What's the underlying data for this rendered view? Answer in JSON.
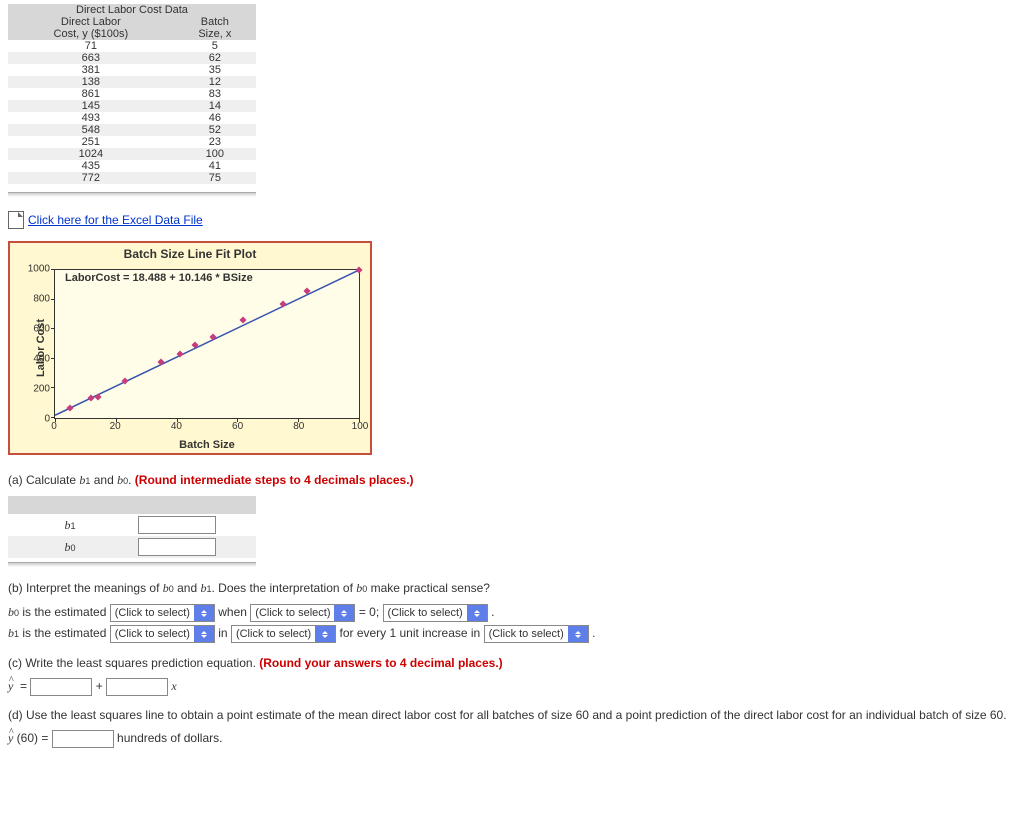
{
  "table": {
    "title": "Direct Labor Cost Data",
    "col1_a": "Direct Labor",
    "col1_b": "Cost, y ($100s)",
    "col2_a": "Batch",
    "col2_b": "Size, x",
    "rows": [
      {
        "y": "71",
        "x": "5"
      },
      {
        "y": "663",
        "x": "62"
      },
      {
        "y": "381",
        "x": "35"
      },
      {
        "y": "138",
        "x": "12"
      },
      {
        "y": "861",
        "x": "83"
      },
      {
        "y": "145",
        "x": "14"
      },
      {
        "y": "493",
        "x": "46"
      },
      {
        "y": "548",
        "x": "52"
      },
      {
        "y": "251",
        "x": "23"
      },
      {
        "y": "1024",
        "x": "100"
      },
      {
        "y": "435",
        "x": "41"
      },
      {
        "y": "772",
        "x": "75"
      }
    ]
  },
  "excel_link": "Click here for the Excel Data File",
  "chart_data": {
    "type": "scatter",
    "title": "Batch Size Line Fit Plot",
    "equation_label": "LaborCost = 18.488 + 10.146 * BSize",
    "xlabel": "Batch Size",
    "ylabel": "Labor Cost",
    "xlim": [
      0,
      100
    ],
    "ylim": [
      0,
      1000
    ],
    "x_ticks": [
      0,
      20,
      40,
      60,
      80,
      100
    ],
    "y_ticks": [
      0,
      200,
      400,
      600,
      800,
      1000
    ],
    "points": [
      {
        "x": 5,
        "y": 71
      },
      {
        "x": 62,
        "y": 663
      },
      {
        "x": 35,
        "y": 381
      },
      {
        "x": 12,
        "y": 138
      },
      {
        "x": 83,
        "y": 861
      },
      {
        "x": 14,
        "y": 145
      },
      {
        "x": 46,
        "y": 493
      },
      {
        "x": 52,
        "y": 548
      },
      {
        "x": 23,
        "y": 251
      },
      {
        "x": 100,
        "y": 1024
      },
      {
        "x": 41,
        "y": 435
      },
      {
        "x": 75,
        "y": 772
      }
    ],
    "fit_line": {
      "intercept": 18.488,
      "slope": 10.146
    }
  },
  "qa": {
    "a_prompt_1": "(a) Calculate ",
    "a_prompt_2": " and ",
    "a_prompt_3": ". ",
    "a_round": "(Round intermediate steps to 4 decimals places.)",
    "b1_label": "b",
    "b1_sub": "1",
    "b0_label": "b",
    "b0_sub": "0",
    "b_prompt_1": "(b) Interpret the meanings of ",
    "b_prompt_2": " and ",
    "b_prompt_3": ". Does the interpretation of ",
    "b_prompt_4": " make practical sense?",
    "b0_line_pre": " is the estimated",
    "b1_line_pre": " is the estimated",
    "click_select": "(Click to select)",
    "when": "when",
    "eq0": "= 0;",
    "in": "in",
    "every": "for every 1 unit increase in",
    "dot": ".",
    "c_prompt": "(c) Write the least squares prediction equation. ",
    "c_round": "(Round your answers to 4 decimal places.)",
    "plus": "+",
    "x": "x",
    "eq": "=",
    "d_prompt": "(d) Use the least squares line to obtain a point estimate of the mean direct labor cost for all batches of size 60 and a point prediction of the direct labor cost for an individual batch of size 60.",
    "yhat60_pre": "(60) =",
    "yhat60_post": "hundreds of dollars."
  }
}
